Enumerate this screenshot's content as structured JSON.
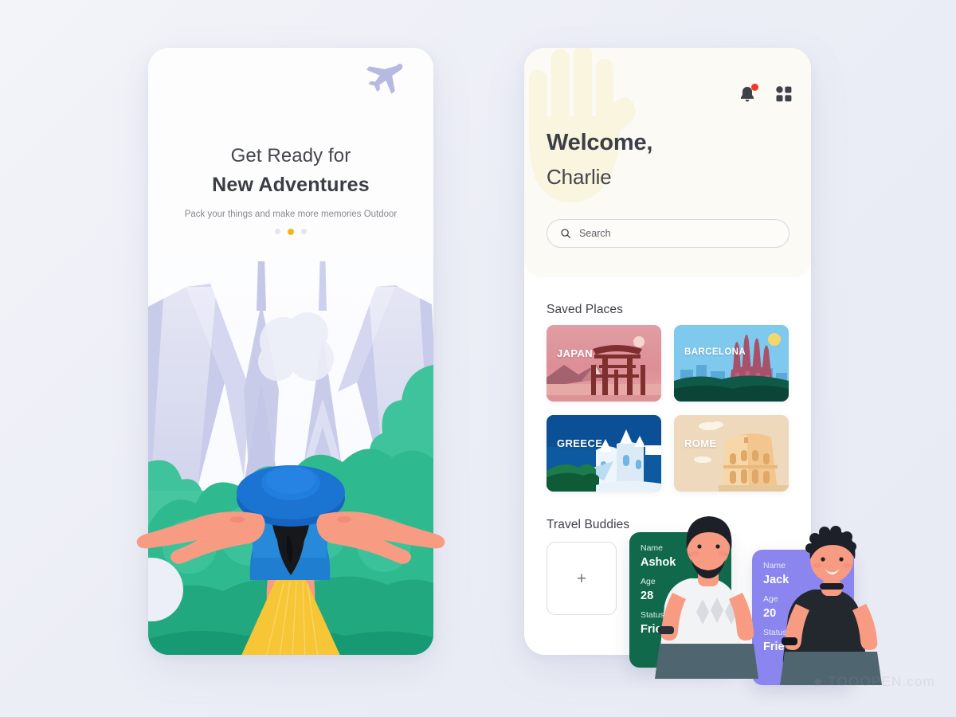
{
  "background_color": "#eceef6",
  "onboarding": {
    "title_line1": "Get Ready for",
    "title_line2": "New Adventures",
    "subtitle": "Pack your things and make more memories Outdoor",
    "plane_icon": "airplane-icon",
    "pagination": {
      "total": 3,
      "active_index": 1
    },
    "illustration": {
      "name": "woman-arms-outstretched-travel-illustration",
      "colors": {
        "hat": "#1565c0",
        "shirt": "#1f7ed0",
        "skirt": "#f7c636",
        "skin": "#f79b82",
        "hair": "#17181c",
        "foliage_light": "#4fc9a0",
        "foliage_dark": "#1f9b76",
        "mountains": "#c0c3e6",
        "sky": "#fbfcff"
      }
    }
  },
  "home": {
    "header": {
      "greeting_line1": "Welcome,",
      "greeting_line2": "Charlie",
      "hand_decoration": "waving-hand-illustration",
      "background_color": "#fbfaf5",
      "icons": [
        {
          "name": "notification-bell-icon",
          "badge": true,
          "badge_color": "#f5342a"
        },
        {
          "name": "grid-menu-icon",
          "badge": false
        }
      ]
    },
    "search": {
      "icon": "search-icon",
      "placeholder": "Search",
      "value": ""
    },
    "saved_places": {
      "title": "Saved Places",
      "cards": [
        {
          "label": "JAPAN",
          "theme_color": "#d98a96",
          "art": "torii-gate-mountain-sunset-illustration"
        },
        {
          "label": "BARCELONA",
          "theme_color": "#7ec8ef",
          "art": "sagrada-familia-skyline-illustration"
        },
        {
          "label": "GREECE",
          "theme_color": "#0d5aa0",
          "art": "santorini-white-buildings-illustration"
        },
        {
          "label": "ROME",
          "theme_color": "#ecd5b4",
          "art": "colosseum-illustration"
        }
      ]
    },
    "travel_buddies": {
      "title": "Travel Buddies",
      "add_button": {
        "name": "add-travel-buddy-button",
        "glyph": "+"
      },
      "field_labels": {
        "name": "Name",
        "age": "Age",
        "status": "Status"
      },
      "buddies": [
        {
          "name": "Ashok",
          "age": "28",
          "status": "Friend",
          "card_color": "#10694b",
          "art": "man-beard-white-shirt-illustration"
        },
        {
          "name": "Jack",
          "age": "20",
          "status": "Friend",
          "card_color": "#8b85ef",
          "art": "man-black-tshirt-illustration"
        }
      ]
    }
  },
  "watermark": {
    "text": "TOOOPEN.com"
  }
}
